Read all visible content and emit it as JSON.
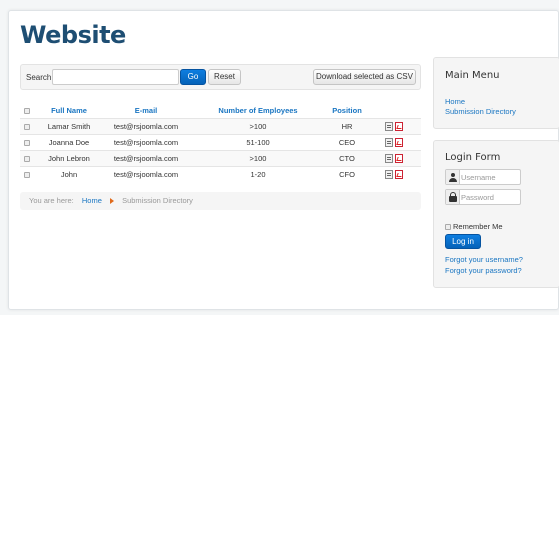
{
  "site": {
    "title": "Website"
  },
  "search": {
    "label": "Search",
    "value": "",
    "go_label": "Go",
    "reset_label": "Reset",
    "csv_label": "Download selected as CSV"
  },
  "table": {
    "columns": [
      "Full Name",
      "E-mail",
      "Number of Employees",
      "Position"
    ],
    "rows": [
      [
        "Lamar Smith",
        "test@rsjoomla.com",
        ">100",
        "HR"
      ],
      [
        "Joanna Doe",
        "test@rsjoomla.com",
        "51-100",
        "CEO"
      ],
      [
        "John Lebron",
        "test@rsjoomla.com",
        ">100",
        "CTO"
      ],
      [
        "John",
        "test@rsjoomla.com",
        "1-20",
        "CFO"
      ]
    ],
    "row_icons": [
      "edit-icon",
      "pdf-icon"
    ]
  },
  "breadcrumb": {
    "prefix": "You are here:",
    "items": [
      "Home",
      "Submission Directory"
    ]
  },
  "main_menu": {
    "title": "Main Menu",
    "items": [
      "Home",
      "Submission Directory"
    ]
  },
  "login_form": {
    "title": "Login Form",
    "username_placeholder": "Username",
    "password_placeholder": "Password",
    "remember_label": "Remember Me",
    "login_label": "Log in",
    "forgot_username": "Forgot your username?",
    "forgot_password": "Forgot your password?"
  },
  "colors": {
    "title": "#1e4e73",
    "link": "#1a76c2",
    "primary_button": "#0562b8",
    "breadcrumb_separator": "#e06a1b"
  }
}
